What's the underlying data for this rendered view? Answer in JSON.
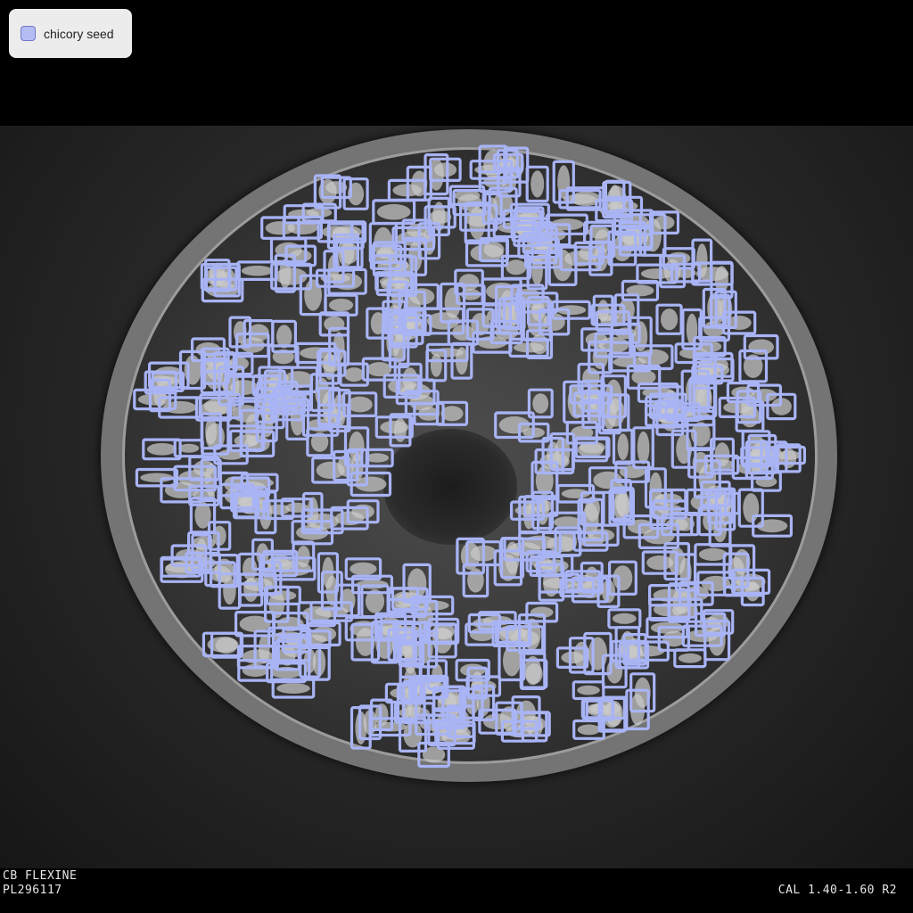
{
  "legend": {
    "label": "chicory seed",
    "color": "#a9b4f5"
  },
  "captions": {
    "line1": "CB FLEXINE",
    "line2": "PL296117",
    "calibration": "CAL 1.40-1.60 R2"
  },
  "annotation": {
    "class_name": "chicory seed",
    "box_color": "#a9b4f5",
    "approximate_box_count": 520
  }
}
